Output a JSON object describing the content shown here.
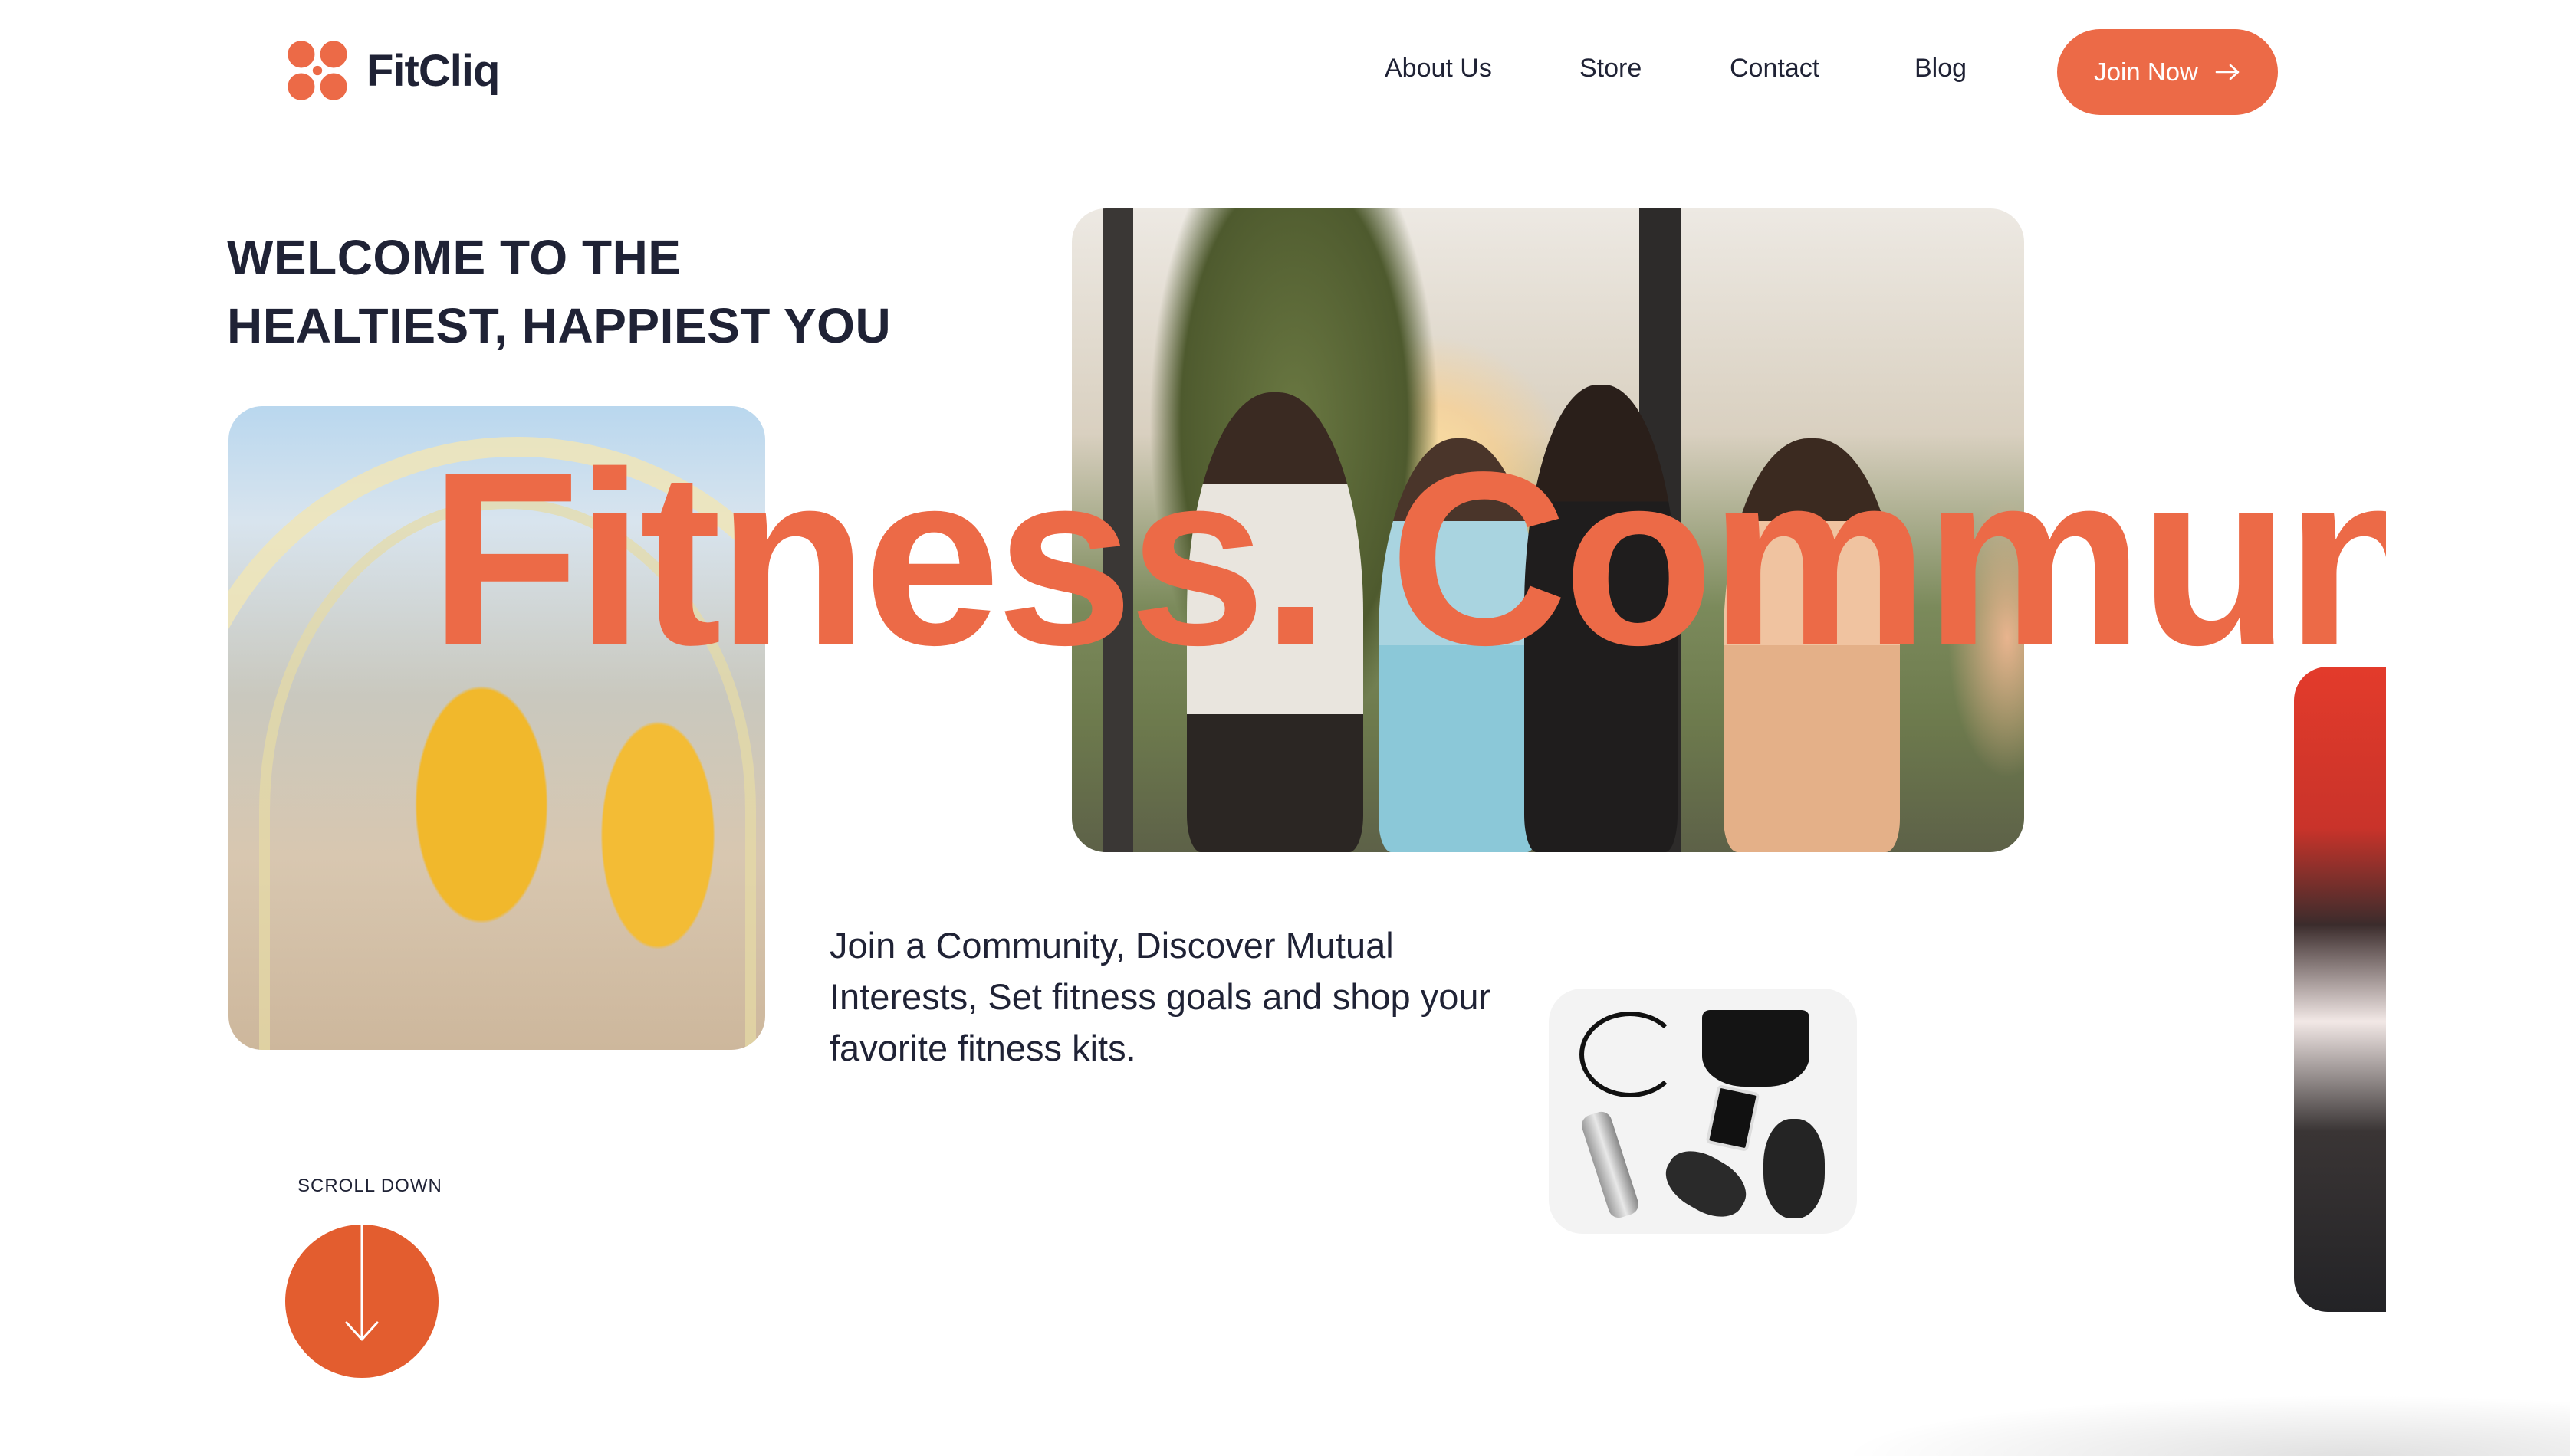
{
  "brand": {
    "name": "FitCliq",
    "accent": "#ec6a47",
    "dark": "#1f2235"
  },
  "nav": {
    "items": [
      {
        "label": "About Us"
      },
      {
        "label": "Store"
      },
      {
        "label": "Contact"
      },
      {
        "label": "Blog"
      }
    ],
    "cta_label": "Join Now",
    "cta_icon": "arrow-right-icon"
  },
  "hero": {
    "headline_line1": "WELCOME TO THE",
    "headline_line2": "HEALTIEST, HAPPIEST YOU",
    "marquee_text": "Fitness. Communi",
    "tagline": "Join a Community, Discover Mutual Interests, Set fitness goals and shop your favorite fitness kits."
  },
  "scroll": {
    "label": "SCROLL DOWN",
    "icon": "arrow-down-icon"
  }
}
